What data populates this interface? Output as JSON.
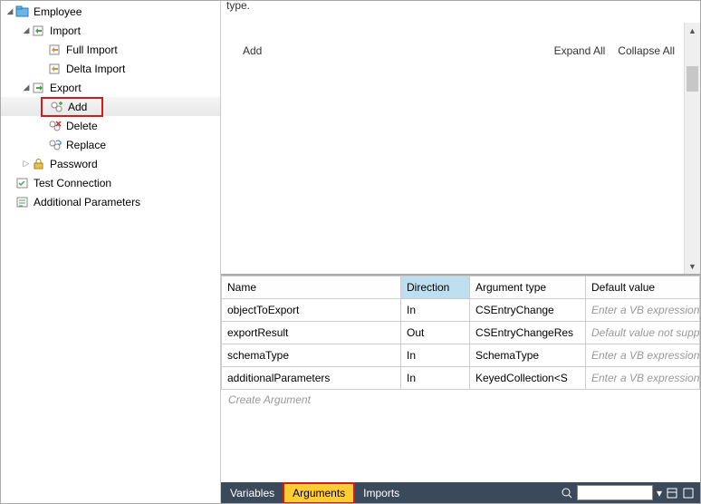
{
  "tree": {
    "employee": "Employee",
    "import": "Import",
    "full_import": "Full Import",
    "delta_import": "Delta Import",
    "export": "Export",
    "add": "Add",
    "delete": "Delete",
    "replace": "Replace",
    "password": "Password",
    "test_connection": "Test Connection",
    "additional_parameters": "Additional Parameters"
  },
  "top": {
    "fragment": "type.",
    "add": "Add",
    "expand_all": "Expand All",
    "collapse_all": "Collapse All"
  },
  "grid": {
    "headers": {
      "name": "Name",
      "direction": "Direction",
      "argtype": "Argument type",
      "default": "Default value"
    },
    "rows": [
      {
        "name": "objectToExport",
        "direction": "In",
        "argtype": "CSEntryChange",
        "default": "Enter a VB expression",
        "ph": true
      },
      {
        "name": "exportResult",
        "direction": "Out",
        "argtype": "CSEntryChangeRes",
        "default": "Default value not suppor",
        "ph": true
      },
      {
        "name": "schemaType",
        "direction": "In",
        "argtype": "SchemaType",
        "default": "Enter a VB expression",
        "ph": true
      },
      {
        "name": "additionalParameters",
        "direction": "In",
        "argtype": "KeyedCollection<S",
        "default": "Enter a VB expression",
        "ph": true
      }
    ],
    "create": "Create Argument"
  },
  "tabs": {
    "variables": "Variables",
    "arguments": "Arguments",
    "imports": "Imports"
  }
}
